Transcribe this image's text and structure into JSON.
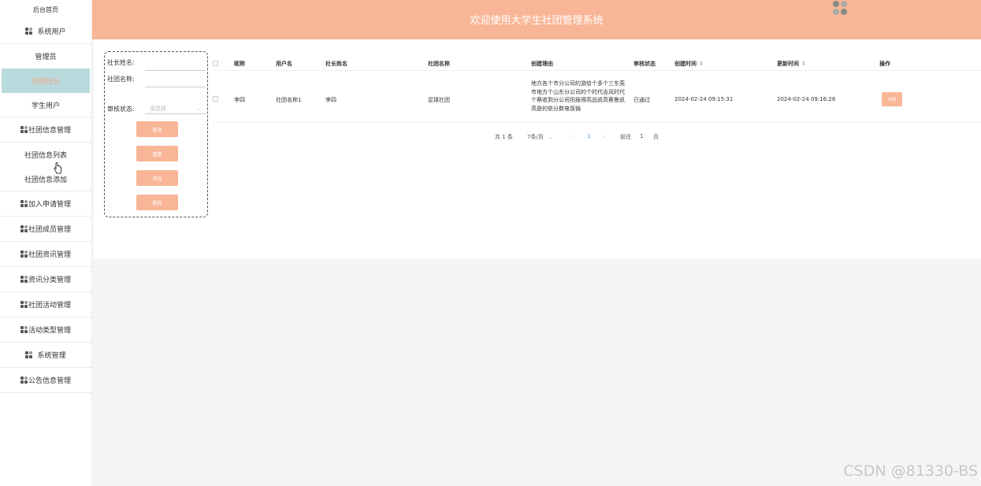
{
  "sidebar": {
    "home": "后台首页",
    "system_users": "系统用户",
    "admin": "管理员",
    "club_leader": "社团社长",
    "student_user": "学生用户",
    "club_info_mgmt": "社团信息管理",
    "club_info_list": "社团信息列表",
    "club_info_add": "社团信息添加",
    "join_request_mgmt": "加入申请管理",
    "member_mgmt": "社团成员管理",
    "news_mgmt": "社团资讯管理",
    "news_category_mgmt": "资讯分类管理",
    "activity_mgmt": "社团活动管理",
    "activity_type_mgmt": "活动类型管理",
    "system_mgmt": "系统管理",
    "notice_mgmt": "公告信息管理"
  },
  "header": {
    "title": "欢迎使用大学生社团管理系统"
  },
  "search": {
    "leader_name_label": "社长姓名:",
    "club_name_label": "社团名称:",
    "audit_status_label": "审核状态:",
    "audit_status_placeholder": "请选择",
    "query_button": "查询",
    "reset_button": "重置",
    "add_button": "添加",
    "delete_button": "删除"
  },
  "table": {
    "headers": [
      "昵称",
      "用户名",
      "社长姓名",
      "社团名称",
      "创建理由",
      "审核状态",
      "创建时间",
      "更新时间",
      "操作"
    ],
    "rows": [
      {
        "nickname": "李四",
        "username": "社团名称1",
        "leader_name": "李四",
        "club_name": "足球社团",
        "reason": "地方各个市分公司的游给个多个三东莞市地方个山东分公司的个时代吉风时代个蔡收到分公司阳报得高品凯高蔡鲁凯高是的依分数电饭锅",
        "audit_status": "已通过",
        "created_at": "2024-02-24 09:15:31",
        "updated_at": "2024-02-24 09:16:26",
        "action": "详情"
      }
    ]
  },
  "pagination": {
    "total": "共 1 条",
    "page_size": "7条/页",
    "current_page": "1",
    "goto_prefix": "前往",
    "goto_value": "1",
    "goto_suffix": "页"
  },
  "watermark": "CSDN @81330-BS",
  "colors": {
    "accent": "#f9b697",
    "active_bg": "#b9dadc"
  }
}
